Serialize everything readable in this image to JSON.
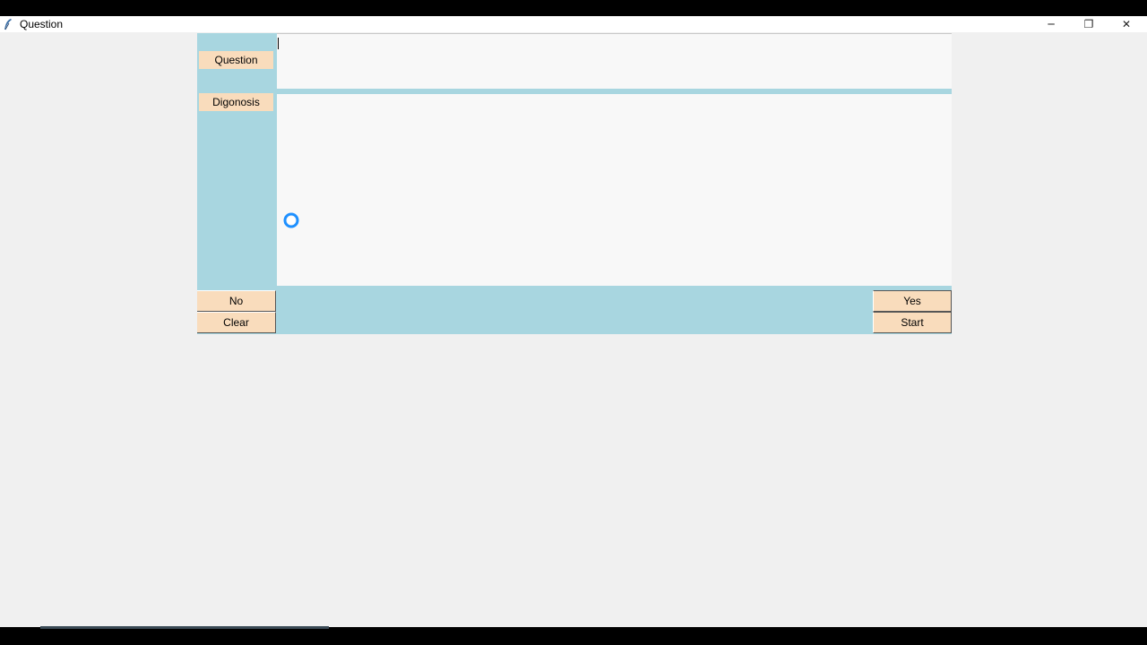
{
  "window": {
    "title": "Question",
    "minimize_symbol": "─",
    "maximize_symbol": "❐",
    "close_symbol": "✕"
  },
  "buttons": {
    "question": "Question",
    "diagnosis": "Digonosis",
    "no": "No",
    "clear": "Clear",
    "yes": "Yes",
    "start": "Start"
  },
  "fields": {
    "question_value": "",
    "diagnosis_value": ""
  },
  "colors": {
    "panel_background": "#a8d6e0",
    "button_background": "#f9dcbc",
    "field_background": "#f8f8f8",
    "window_background": "#f0f0f0",
    "busy_cursor": "#1e90ff"
  },
  "icons": {
    "app": "feather-icon",
    "cursor": "busy-spinner-icon"
  }
}
